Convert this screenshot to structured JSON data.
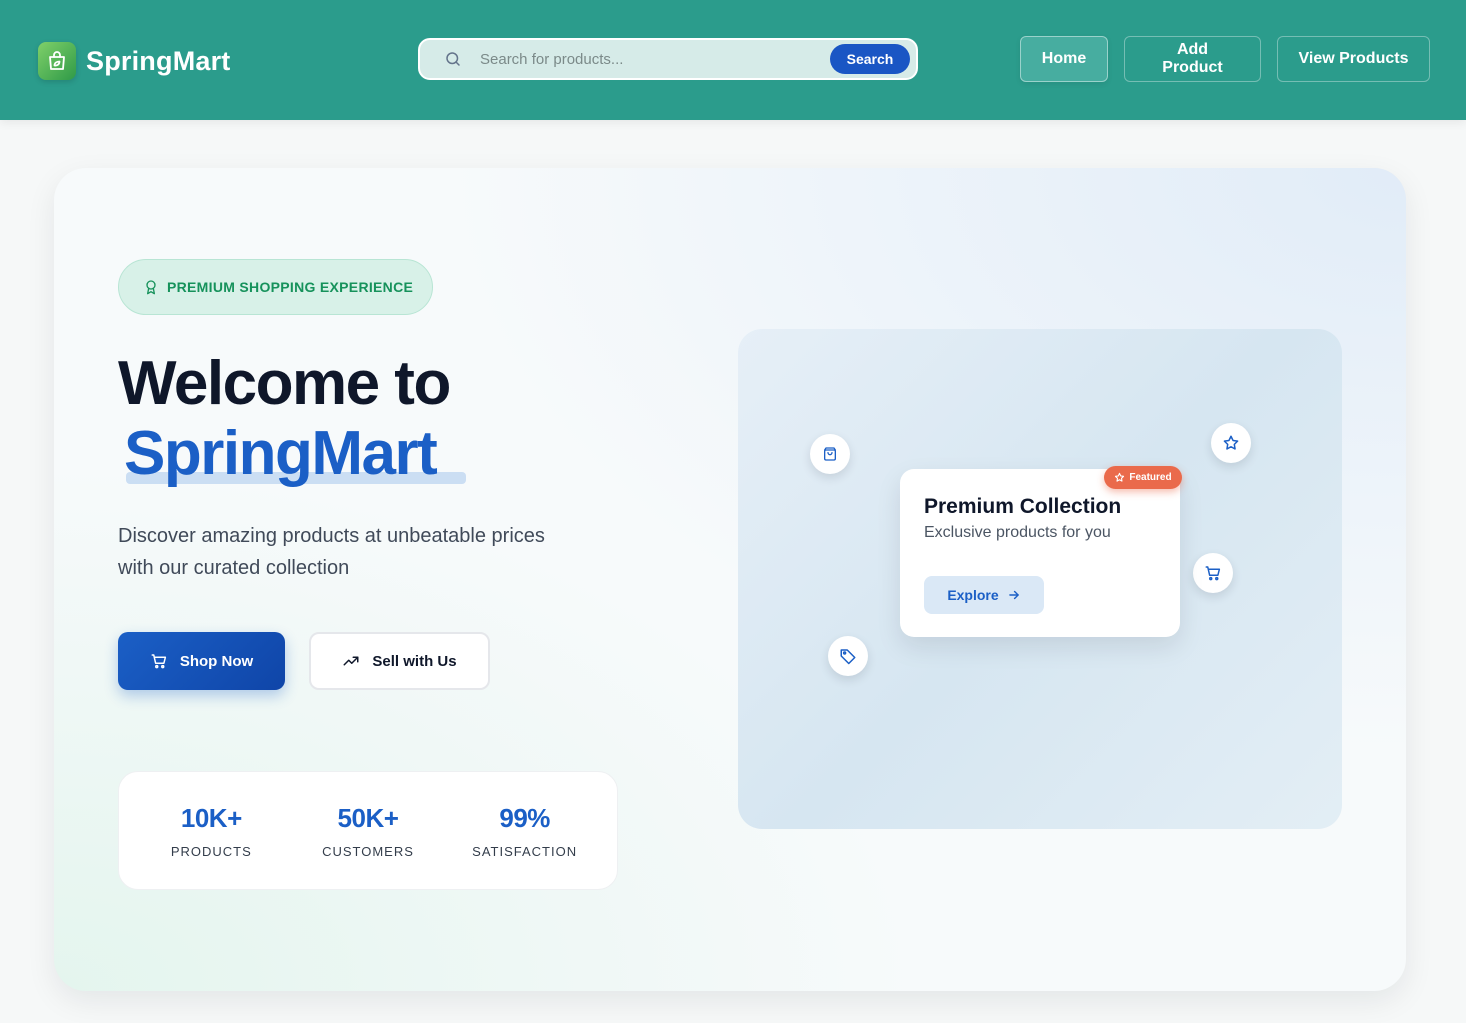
{
  "brand": {
    "name": "SpringMart",
    "accent": "#2b9c8c",
    "primary": "#1b5fc6"
  },
  "search": {
    "placeholder": "Search for products...",
    "button_label": "Search"
  },
  "nav": [
    {
      "label": "Home",
      "active": true
    },
    {
      "label": "Add Product",
      "active": false
    },
    {
      "label": "View Products",
      "active": false
    }
  ],
  "hero": {
    "badge": "PREMIUM SHOPPING EXPERIENCE",
    "title_line1": "Welcome to",
    "title_line2": "SpringMart",
    "subtitle": "Discover amazing products at unbeatable prices with our curated collection",
    "primary_button": "Shop Now",
    "secondary_button": "Sell with Us"
  },
  "stats": [
    {
      "value": "10K+",
      "label": "PRODUCTS"
    },
    {
      "value": "50K+",
      "label": "CUSTOMERS"
    },
    {
      "value": "99%",
      "label": "SATISFACTION"
    }
  ],
  "showcase": {
    "badge": "Featured",
    "card_title": "Premium Collection",
    "card_subtitle": "Exclusive products for you",
    "card_button": "Explore",
    "floating_icons": [
      "shopping-bag-icon",
      "star-icon",
      "cart-icon",
      "tag-icon"
    ]
  }
}
